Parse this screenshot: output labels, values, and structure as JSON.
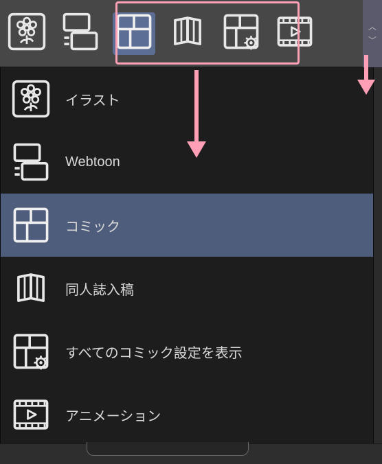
{
  "toolbar": {
    "items": [
      {
        "id": "illustration",
        "name": "illustration-icon"
      },
      {
        "id": "webtoon",
        "name": "webtoon-icon"
      },
      {
        "id": "comic",
        "name": "comic-icon",
        "selected": true
      },
      {
        "id": "doujin",
        "name": "doujin-icon"
      },
      {
        "id": "comic-settings",
        "name": "comic-settings-icon"
      },
      {
        "id": "animation",
        "name": "animation-icon"
      }
    ]
  },
  "menu": {
    "items": [
      {
        "id": "illustration",
        "label": "イラスト"
      },
      {
        "id": "webtoon",
        "label": "Webtoon"
      },
      {
        "id": "comic",
        "label": "コミック",
        "selected": true
      },
      {
        "id": "doujin",
        "label": "同人誌入稿"
      },
      {
        "id": "comic-settings",
        "label": "すべてのコミック設定を表示"
      },
      {
        "id": "animation",
        "label": "アニメーション"
      }
    ]
  },
  "annotations": {
    "highlight_group": [
      "comic",
      "doujin",
      "comic-settings"
    ],
    "arrow_color": "#ff9fb5"
  }
}
